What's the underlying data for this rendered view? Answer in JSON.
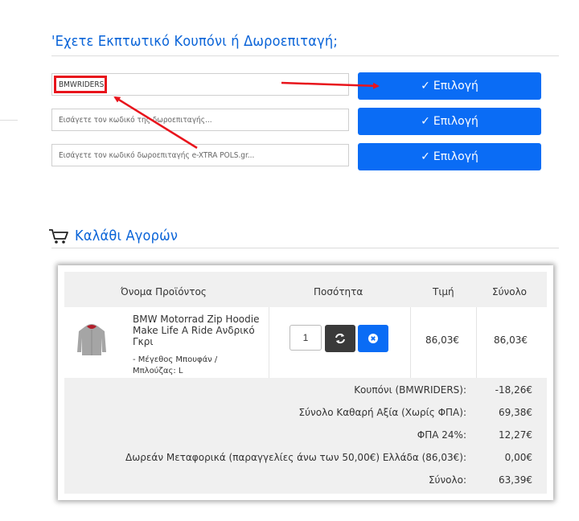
{
  "coupon_section": {
    "title": "'Εχετε Εκπτωτικό Κουπόνι ή Δωροεπιταγή;",
    "coupon_value": "BMWRIDERS",
    "voucher_placeholder": "Εισάγετε τον κωδικό της δωροεπιταγής...",
    "extra_placeholder": "Εισάγετε τον κωδικό δωροεπιταγής e-XTRA POLS.gr...",
    "apply_label": "Επιλογή",
    "check_glyph": "✓"
  },
  "cart": {
    "title": "Καλάθι Αγορών",
    "columns": {
      "product": "Όνομα Προϊόντος",
      "quantity": "Ποσότητα",
      "price": "Τιμή",
      "total": "Σύνολο"
    },
    "item": {
      "name": "BMW Motorrad Zip Hoodie Make Life A Ride Ανδρικό Γκρι",
      "option": "- Μέγεθος Μπουφάν / Μπλούζας: L",
      "quantity": "1",
      "price": "86,03€",
      "total": "86,03€"
    },
    "totals": [
      {
        "label": "Κουπόνι (BMWRIDERS):",
        "value": "-18,26€"
      },
      {
        "label": "Σύνολο Καθαρή Αξία (Χωρίς ΦΠΑ):",
        "value": "69,38€"
      },
      {
        "label": "ΦΠΑ 24%:",
        "value": "12,27€"
      },
      {
        "label": "Δωρεάν Μεταφορικά (παραγγελίες άνω των 50,00€) Ελλάδα (86,03€):",
        "value": "0,00€"
      },
      {
        "label": "Σύνολο:",
        "value": "63,39€"
      }
    ]
  },
  "colors": {
    "accent": "#0a6cf5",
    "title": "#0a64d8",
    "annotation": "#e8141c"
  }
}
